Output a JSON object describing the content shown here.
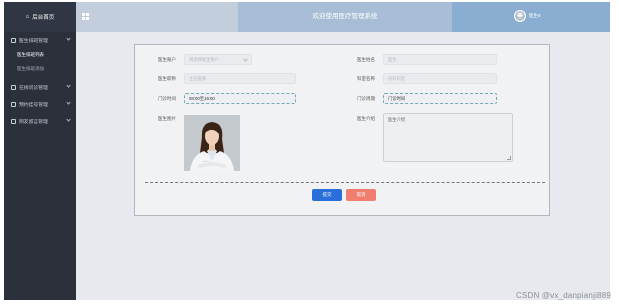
{
  "sidebar": {
    "home_label": "后台首页",
    "groups": [
      {
        "label": "医生排班管理",
        "submenu": [
          "医生排班列表",
          "医生排班添加"
        ]
      },
      {
        "label": "在线问诊管理"
      },
      {
        "label": "预约挂号管理"
      },
      {
        "label": "网友留言管理"
      }
    ]
  },
  "header": {
    "title": "欢迎使用医疗管理系统",
    "user_name": "医生9"
  },
  "form": {
    "doctor_account": {
      "label": "医生账户",
      "placeholder": "请选择医生账户"
    },
    "doctor_name": {
      "label": "医生姓名",
      "placeholder": "医生"
    },
    "doctor_title": {
      "label": "医生职称",
      "placeholder": "主任医师"
    },
    "department": {
      "label": "科室名称",
      "placeholder": "内科科室"
    },
    "clinic_time": {
      "label": "门诊时间",
      "value": "08:00至16:00"
    },
    "clinic_days": {
      "label": "门诊周期",
      "value": "门诊时间"
    },
    "photo": {
      "label": "医生图片"
    },
    "intro": {
      "label": "医生介绍",
      "value": "医生介绍"
    }
  },
  "buttons": {
    "submit": "提交",
    "cancel": "取消"
  },
  "watermark": "CSDN @vx_danpianji889",
  "colors": {
    "sidebar_bg": "#2b303b",
    "header_bg": "#a8bed6",
    "submit": "#2a6fd9",
    "cancel": "#f07d6d"
  }
}
